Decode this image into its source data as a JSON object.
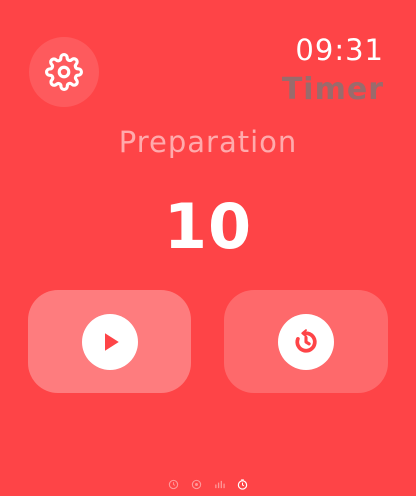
{
  "header": {
    "time": "09:31",
    "app_title": "Timer"
  },
  "timer": {
    "phase": "Preparation",
    "countdown": "10"
  },
  "icons": {
    "settings": "gear-icon",
    "play": "play-icon",
    "reset": "reset-icon",
    "pages": [
      "timer-page-icon",
      "settings-page-icon",
      "stats-page-icon",
      "stopwatch-page-icon"
    ]
  },
  "colors": {
    "background": "#fe4447",
    "icon_fill": "#fe4447",
    "text": "#ffffff",
    "title_gray": "#8a8a8a"
  },
  "page_indicator": {
    "active_index": 3
  }
}
